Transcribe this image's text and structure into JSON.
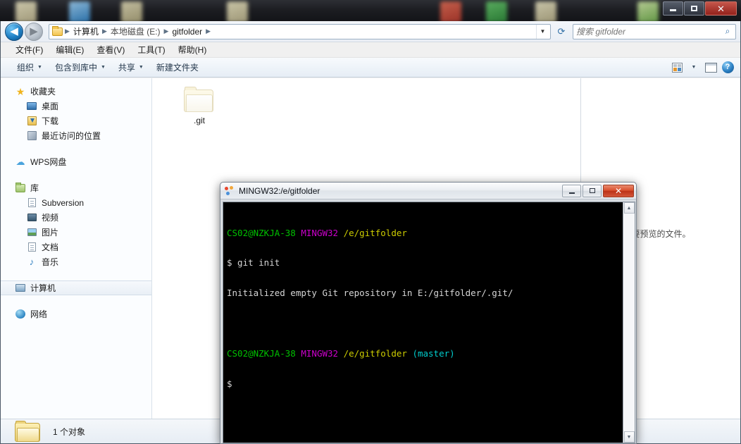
{
  "window": {
    "min_label": "",
    "max_label": "",
    "close_label": "✕"
  },
  "address": {
    "back_glyph": "◀",
    "forward_glyph": "▶",
    "crumbs": [
      {
        "label": "计算机"
      },
      {
        "label": "本地磁盘 (E:)"
      },
      {
        "label": "gitfolder"
      }
    ],
    "separator": "▶",
    "dropdown_glyph": "▼",
    "refresh_glyph": "⟳"
  },
  "search": {
    "placeholder": "搜索 gitfolder",
    "value": "",
    "icon_glyph": "⌕"
  },
  "menubar": {
    "items": [
      {
        "label": "文件(F)"
      },
      {
        "label": "编辑(E)"
      },
      {
        "label": "查看(V)"
      },
      {
        "label": "工具(T)"
      },
      {
        "label": "帮助(H)"
      }
    ]
  },
  "toolbar": {
    "items": [
      {
        "label": "组织",
        "caret": "▼"
      },
      {
        "label": "包含到库中",
        "caret": "▼"
      },
      {
        "label": "共享",
        "caret": "▼"
      },
      {
        "label": "新建文件夹",
        "caret": ""
      }
    ],
    "view_caret": "▼",
    "help_glyph": "?"
  },
  "navpane": {
    "groups": [
      {
        "header": {
          "label": "收藏夹",
          "icon": "star-icon"
        },
        "items": [
          {
            "label": "桌面",
            "icon": "desktop-icon"
          },
          {
            "label": "下载",
            "icon": "downloads-icon"
          },
          {
            "label": "最近访问的位置",
            "icon": "recent-places-icon"
          }
        ]
      },
      {
        "header": {
          "label": "WPS网盘",
          "icon": "cloud-icon"
        },
        "items": []
      },
      {
        "header": {
          "label": "库",
          "icon": "library-icon"
        },
        "items": [
          {
            "label": "Subversion",
            "icon": "document-icon"
          },
          {
            "label": "视频",
            "icon": "video-icon"
          },
          {
            "label": "图片",
            "icon": "picture-icon"
          },
          {
            "label": "文档",
            "icon": "document-icon"
          },
          {
            "label": "音乐",
            "icon": "music-icon"
          }
        ]
      },
      {
        "header": {
          "label": "计算机",
          "icon": "computer-icon",
          "selected": true
        },
        "items": []
      },
      {
        "header": {
          "label": "网络",
          "icon": "network-icon"
        },
        "items": []
      }
    ]
  },
  "filelist": {
    "items": [
      {
        "name": ".git",
        "icon": "folder-icon-hidden"
      }
    ]
  },
  "preview": {
    "text": "要预览的文件。"
  },
  "statusbar": {
    "text": "1 个对象",
    "icon": "folder-icon"
  },
  "terminal": {
    "title": "MINGW32:/e/gitfolder",
    "min_label": "",
    "max_label": "",
    "close_label": "✕",
    "scroll_up_glyph": "▲",
    "scroll_down_glyph": "▼",
    "lines": [
      {
        "type": "prompt",
        "user": "CS02@NZKJA-38",
        "host": "MINGW32",
        "path": "/e/gitfolder",
        "branch": ""
      },
      {
        "type": "command",
        "text": "$ git init"
      },
      {
        "type": "output",
        "text": "Initialized empty Git repository in E:/gitfolder/.git/"
      },
      {
        "type": "blank",
        "text": ""
      },
      {
        "type": "prompt",
        "user": "CS02@NZKJA-38",
        "host": "MINGW32",
        "path": "/e/gitfolder",
        "branch": "(master)"
      },
      {
        "type": "command",
        "text": "$"
      }
    ]
  },
  "colors": {
    "term_user": "#00c000",
    "term_host": "#cc00cc",
    "term_path": "#cdcd00",
    "term_branch": "#00cdcd",
    "term_text": "#d6d6d6",
    "term_bg": "#000000",
    "explorer_bg": "#f0f0f0"
  }
}
